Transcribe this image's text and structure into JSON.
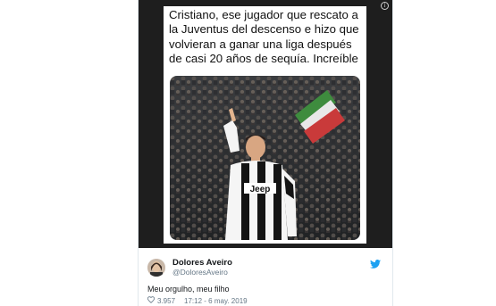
{
  "meme": {
    "caption": "Cristiano, ese jugador que rescato a la Juventus del descenso e hizo que volvieran a ganar una liga después de casi 20 años de sequía. Increíble"
  },
  "photo": {
    "jersey_text": "Jeep"
  },
  "tweet": {
    "author_name": "Dolores Aveiro",
    "author_handle": "@DoloresAveiro",
    "text": "Meu orgulho, meu filho",
    "likes": "3.957",
    "timestamp": "17:12 - 6 may. 2019"
  },
  "colors": {
    "twitter_blue": "#1da1f2",
    "meme_background": "#1e1e1e",
    "muted_text": "#657786"
  },
  "icons": [
    "info-icon",
    "twitter-bird-icon",
    "heart-icon"
  ]
}
